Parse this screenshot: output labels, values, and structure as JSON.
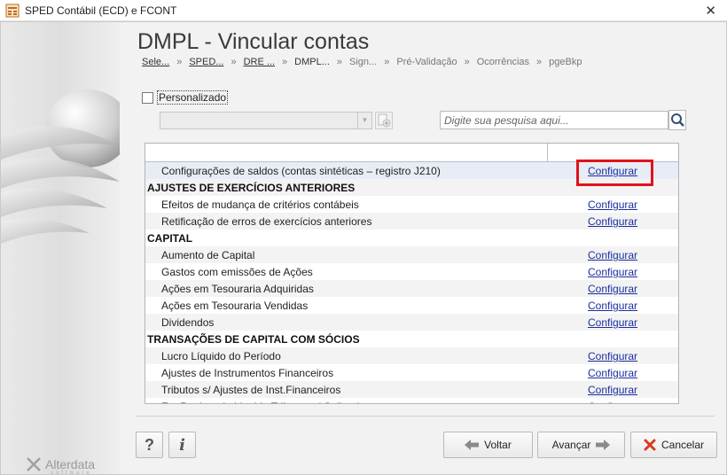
{
  "window": {
    "title": "SPED Contábil (ECD) e FCONT",
    "close_glyph": "✕"
  },
  "page": {
    "title": "DMPL - Vincular contas"
  },
  "breadcrumb": [
    {
      "label": "Sele...",
      "state": "done"
    },
    {
      "label": "SPED...",
      "state": "done"
    },
    {
      "label": "DRE ...",
      "state": "done"
    },
    {
      "label": "DMPL...",
      "state": "current"
    },
    {
      "label": "Sign...",
      "state": "pending"
    },
    {
      "label": "Pré-Validação",
      "state": "pending"
    },
    {
      "label": "Ocorrências",
      "state": "pending"
    },
    {
      "label": "pgeBkp",
      "state": "pending"
    }
  ],
  "breadcrumb_sep": "»",
  "filters": {
    "personalizado_label": "Personalizado",
    "personalizado_checked": false,
    "search_placeholder": "Digite sua pesquisa aqui..."
  },
  "grid": {
    "action_label": "Configurar",
    "rows": [
      {
        "type": "item",
        "label": "Configurações de saldos (contas sintéticas – registro J210)",
        "action": "Configurar",
        "selected": true
      },
      {
        "type": "group",
        "label": "AJUSTES DE EXERCÍCIOS ANTERIORES"
      },
      {
        "type": "item",
        "label": "Efeitos de mudança de critérios contábeis",
        "action": "Configurar"
      },
      {
        "type": "item",
        "label": "Retificação de erros de exercícios anteriores",
        "action": "Configurar"
      },
      {
        "type": "group",
        "label": "CAPITAL"
      },
      {
        "type": "item",
        "label": "Aumento de Capital",
        "action": "Configurar"
      },
      {
        "type": "item",
        "label": "Gastos com emissões de Ações",
        "action": "Configurar"
      },
      {
        "type": "item",
        "label": "Ações em Tesouraria Adquiridas",
        "action": "Configurar"
      },
      {
        "type": "item",
        "label": "Ações em Tesouraria Vendidas",
        "action": "Configurar"
      },
      {
        "type": "item",
        "label": "Dividendos",
        "action": "Configurar"
      },
      {
        "type": "group",
        "label": "TRANSAÇÕES DE CAPITAL COM SÓCIOS"
      },
      {
        "type": "item",
        "label": "Lucro Líquido do Período",
        "action": "Configurar"
      },
      {
        "type": "item",
        "label": "Ajustes de Instrumentos Financeiros",
        "action": "Configurar"
      },
      {
        "type": "item",
        "label": "Tributos s/ Ajustes de Inst.Financeiros",
        "action": "Configurar"
      },
      {
        "type": "item",
        "label": "Em Patrimonio Liquido Tributos s/ Coligadas",
        "action": "Configurar",
        "partial": true
      }
    ]
  },
  "footer": {
    "help_label": "?",
    "info_label": "i",
    "back_label": "Voltar",
    "next_label": "Avançar",
    "cancel_label": "Cancelar"
  },
  "brand": {
    "name": "Alterdata",
    "sub": "software"
  },
  "colors": {
    "link": "#1a2f9e",
    "highlight": "#e0121b",
    "cancel_icon": "#d83a1c"
  }
}
